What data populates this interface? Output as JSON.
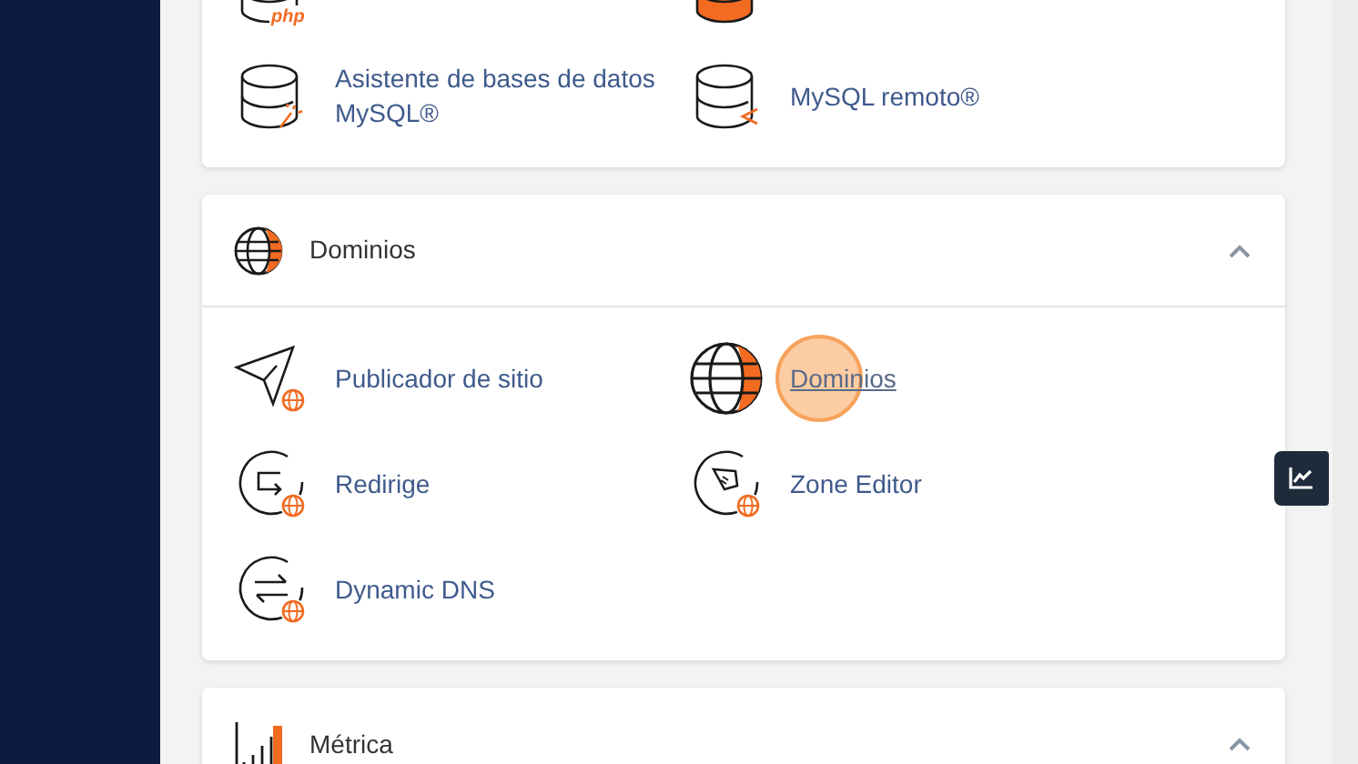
{
  "sections": [
    {
      "items": [
        {
          "kind": "php-db",
          "badge": "php"
        },
        {
          "kind": "db-solid"
        },
        {
          "label": "Asistente de bases de datos MySQL®",
          "kind": "db-wand"
        },
        {
          "label": "MySQL remoto®",
          "kind": "db-remote"
        }
      ]
    },
    {
      "title": "Dominios",
      "kind": "globe",
      "expanded": true,
      "items": [
        {
          "label": "Publicador de sitio",
          "kind": "plane"
        },
        {
          "label": "Dominios",
          "kind": "globe-big",
          "highlighted": true
        },
        {
          "label": "Redirige",
          "kind": "redirect"
        },
        {
          "label": "Zone Editor",
          "kind": "rocket"
        },
        {
          "label": "Dynamic DNS",
          "kind": "arrows"
        }
      ]
    },
    {
      "title": "Métrica",
      "kind": "bars",
      "expanded": true
    }
  ]
}
